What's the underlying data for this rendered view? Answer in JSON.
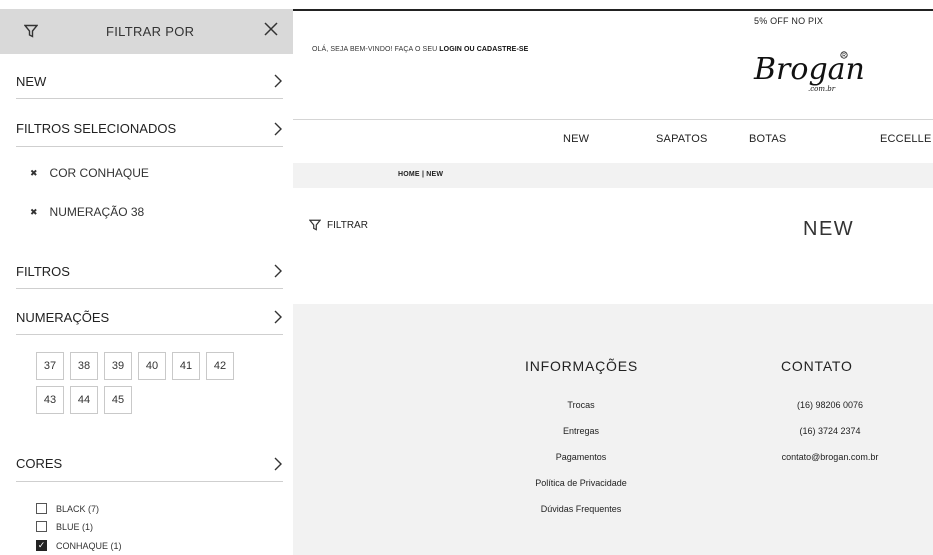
{
  "sidebar": {
    "title": "FILTRAR POR",
    "sections": {
      "new": "NEW",
      "selected": "FILTROS SELECIONADOS",
      "filters": "FILTROS",
      "sizes": "NUMERAÇÕES",
      "colors": "CORES"
    },
    "selected_filters": [
      "COR CONHAQUE",
      "NUMERAÇÃO 38"
    ],
    "size_options": [
      "37",
      "38",
      "39",
      "40",
      "41",
      "42",
      "43",
      "44",
      "45"
    ],
    "color_options": [
      {
        "label": "BLACK (7)",
        "checked": false
      },
      {
        "label": "BLUE (1)",
        "checked": false
      },
      {
        "label": "CONHAQUE (1)",
        "checked": true
      }
    ]
  },
  "header": {
    "welcome_prefix": "OLÁ, SEJA BEM-VINDO! FAÇA O SEU ",
    "welcome_login": "LOGIN OU CADASTRE-SE",
    "promo": "5% OFF NO PIX",
    "logo_text": "Brogan",
    "logo_sub": ".com.br",
    "nav": [
      "NEW",
      "SAPATOS",
      "BOTAS",
      "ECCELLE"
    ]
  },
  "breadcrumb": "HOME |  NEW",
  "filter_button": "FILTRAR",
  "page_title": "NEW",
  "footer": {
    "info": {
      "title": "INFORMAÇÕES",
      "links": [
        "Trocas",
        "Entregas",
        "Pagamentos",
        "Política de Privacidade",
        "Dúvidas Frequentes"
      ]
    },
    "contact": {
      "title": "CONTATO",
      "lines": [
        "(16) 98206 0076",
        "(16) 3724 2374",
        "contato@brogan.com.br"
      ]
    }
  }
}
